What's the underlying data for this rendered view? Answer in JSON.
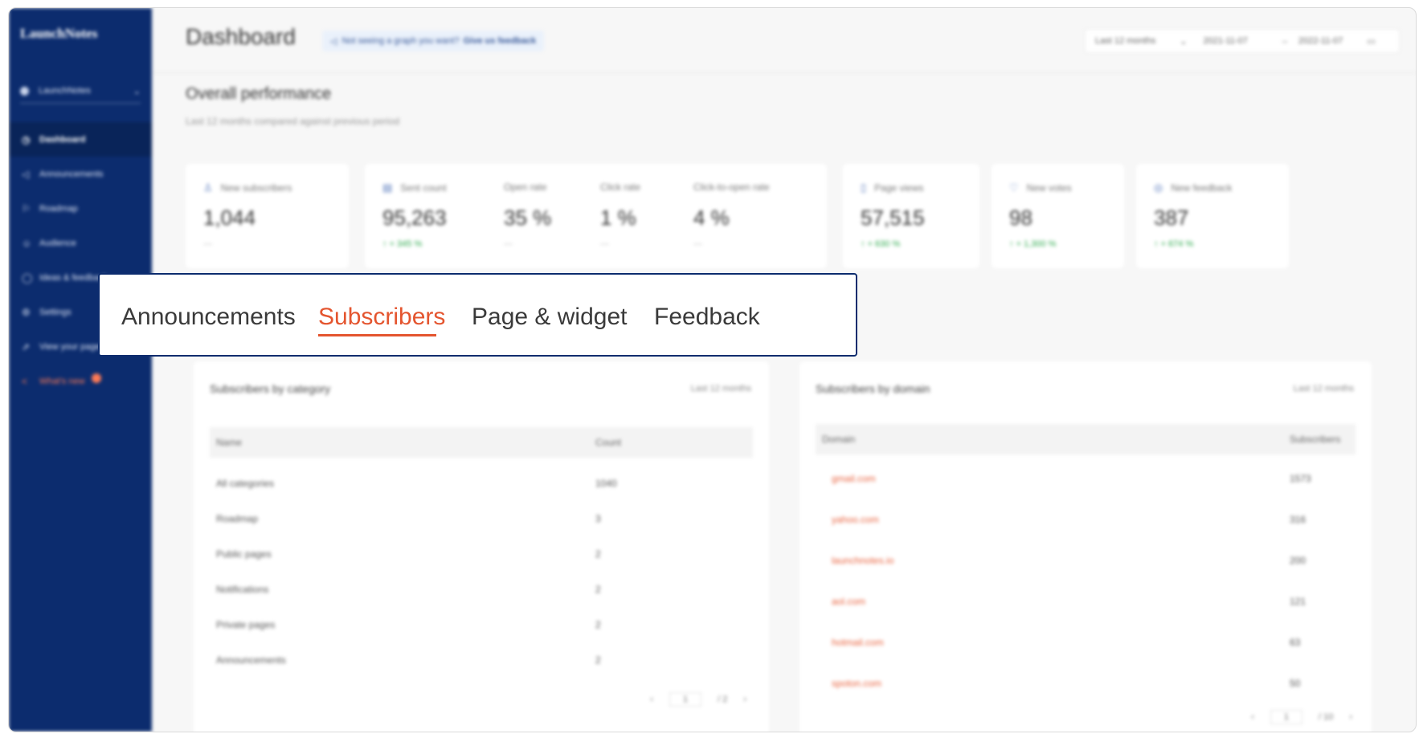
{
  "sidebar": {
    "logo": "LaunchNotes",
    "workspace": "LaunchNotes",
    "items": [
      {
        "label": "Dashboard",
        "icon": "clock-icon"
      },
      {
        "label": "Announcements",
        "icon": "megaphone-icon"
      },
      {
        "label": "Roadmap",
        "icon": "roadmap-icon"
      },
      {
        "label": "Audience",
        "icon": "users-icon"
      },
      {
        "label": "Ideas & feedback",
        "icon": "lightbulb-icon"
      },
      {
        "label": "Settings",
        "icon": "gear-icon"
      },
      {
        "label": "View your pages",
        "icon": "external-link-icon"
      },
      {
        "label": "What's new",
        "icon": "share-icon"
      }
    ]
  },
  "header": {
    "title": "Dashboard",
    "hint_text": "Not seeing a graph you want?",
    "hint_link": "Give us feedback",
    "range_select": "Last 12 months",
    "date_from": "2021-11-07",
    "date_to": "2022-11-07"
  },
  "overview": {
    "title": "Overall performance",
    "subtitle": "Last 12 months compared against previous period",
    "metrics": [
      {
        "label": "New subscribers",
        "value": "1,044",
        "delta": "—"
      },
      {
        "label": "Sent count",
        "value": "95,263",
        "delta": "+ 345 %"
      },
      {
        "label": "Open rate",
        "value": "35 %",
        "delta": "—"
      },
      {
        "label": "Click rate",
        "value": "1 %",
        "delta": "—"
      },
      {
        "label": "Click-to-open rate",
        "value": "4 %",
        "delta": "—"
      },
      {
        "label": "Page views",
        "value": "57,515",
        "delta": "+ 630 %"
      },
      {
        "label": "New votes",
        "value": "98",
        "delta": "+ 1,300 %"
      },
      {
        "label": "New feedback",
        "value": "387",
        "delta": "+ 674 %"
      }
    ]
  },
  "tabs": [
    "Announcements",
    "Subscribers",
    "Page & widget",
    "Feedback"
  ],
  "active_tab": "Subscribers",
  "category_panel": {
    "title": "Subscribers by category",
    "range": "Last 12 months",
    "columns": [
      "Name",
      "Count"
    ],
    "rows": [
      [
        "All categories",
        "1040"
      ],
      [
        "Roadmap",
        "3"
      ],
      [
        "Public pages",
        "2"
      ],
      [
        "Notifications",
        "2"
      ],
      [
        "Private pages",
        "2"
      ],
      [
        "Announcements",
        "2"
      ]
    ],
    "page": "1",
    "pages": "/ 2"
  },
  "domain_panel": {
    "title": "Subscribers by domain",
    "range": "Last 12 months",
    "columns": [
      "Domain",
      "Subscribers"
    ],
    "rows": [
      [
        "gmail.com",
        "1573"
      ],
      [
        "yahoo.com",
        "316"
      ],
      [
        "launchnotes.io",
        "200"
      ],
      [
        "aol.com",
        "121"
      ],
      [
        "hotmail.com",
        "63"
      ],
      [
        "spoton.com",
        "50"
      ]
    ],
    "page": "1",
    "pages": "/ 10"
  },
  "colors": {
    "sidebar": "#0c2c6e",
    "accent": "#e4552f",
    "positive": "#2aa84a"
  }
}
